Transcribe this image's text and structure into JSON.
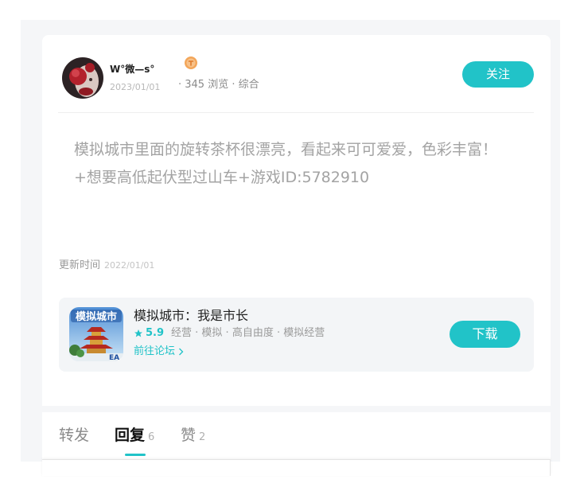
{
  "post": {
    "author": {
      "name": "W°微—s°",
      "date": "2023/01/01",
      "avatar_icon": "user-avatar",
      "badge_icon": "orange-level-badge-icon"
    },
    "stats": "· 345 浏览 · 综合",
    "follow_label": "关注",
    "content": {
      "line1": "模拟城市里面的旋转茶杯很漂亮，看起来可可爱爱，色彩丰富！",
      "line2": "+想要高低起伏型过山车+游戏ID:5782910"
    },
    "updated": {
      "label": "更新时间",
      "date": "2022/01/01"
    }
  },
  "game": {
    "icon_name": "simcity-game-icon",
    "icon_logo_text": "模拟城市",
    "icon_brand": "EA",
    "title": "模拟城市：我是市长",
    "rating_icon": "star-icon",
    "rating": "5.9",
    "tags": "经营 · 模拟 · 高自由度 · 模拟经营",
    "forum_link": "前往论坛",
    "forum_link_icon": "chevron-right-icon",
    "download_label": "下载"
  },
  "tabs": [
    {
      "label": "转发"
    },
    {
      "label": "回复",
      "count": "6",
      "active": true
    },
    {
      "label": "赞",
      "count": "2"
    }
  ],
  "theme": {
    "accent": "#21c3c8",
    "panel_bg": "#f5f6f8"
  }
}
